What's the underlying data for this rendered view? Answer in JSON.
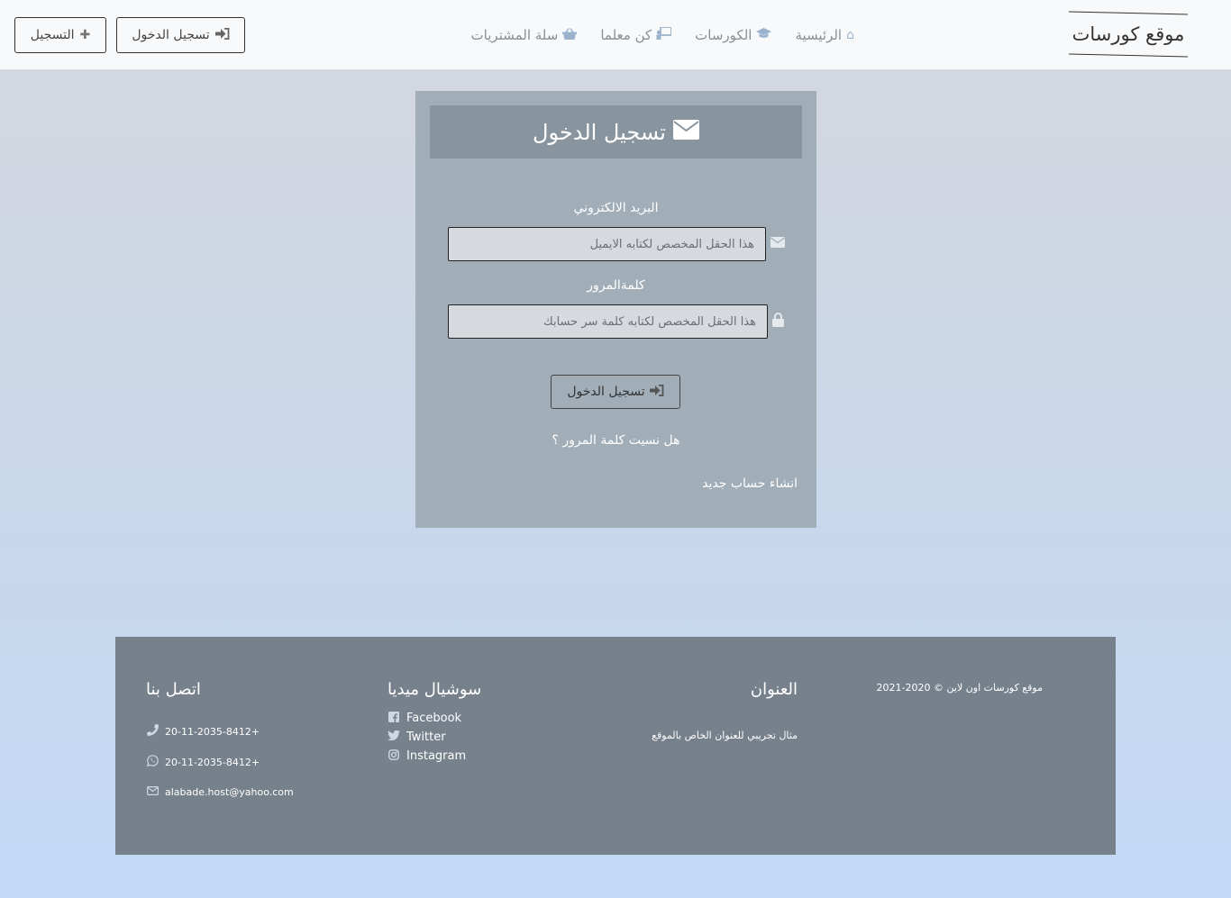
{
  "navbar": {
    "brand": "موقع كورسات",
    "links": [
      {
        "label": "الرئيسية",
        "icon": "home-icon",
        "glyph": "⌂"
      },
      {
        "label": "الكورسات",
        "icon": "graduation-cap-icon",
        "glyph": "🎓"
      },
      {
        "label": "كن معلما",
        "icon": "chalkboard-teacher-icon",
        "glyph": "▣"
      },
      {
        "label": "سلة المشتريات",
        "icon": "shopping-basket-icon",
        "glyph": "⊟"
      }
    ],
    "login_label": "تسجيل الدخول",
    "register_label": "التسجيل"
  },
  "login_card": {
    "title": "تسجيل الدخول",
    "email_label": "البريد الالكتروني",
    "email_placeholder": "هذا الحقل المخصص لكتابه الايميل",
    "password_label": "كلمةالمرور",
    "password_placeholder": "هذا الحقل المخصص لكتابه كلمة سر حسابك",
    "submit_label": "تسجيل الدخول",
    "forgot_label": "هل نسيت كلمة المرور ؟",
    "new_account_label": "انشاء حساب جديد"
  },
  "footer": {
    "copyright": "موقع كورسات اون لاين © 2020-2021",
    "address_title": "العنوان",
    "address_text": "مثال تجريبي للعنوان الخاص بالموقع",
    "social_title": "سوشيال ميديا",
    "social": [
      {
        "label": "Facebook",
        "icon": "facebook-icon"
      },
      {
        "label": "Twitter",
        "icon": "twitter-icon"
      },
      {
        "label": "Instagram",
        "icon": "instagram-icon"
      }
    ],
    "contact_title": "اتصل بنا",
    "phone": "20-11-2035-8412+",
    "whatsapp": "20-11-2035-8412+",
    "email": "alabade.host@yahoo.com"
  },
  "colors": {
    "navbar_bg": "#f8f9fa",
    "card_bg": "#a1adb7",
    "card_header_bg": "#88959e",
    "footer_bg": "#77818c",
    "icon_accent": "#9ab2cc"
  }
}
